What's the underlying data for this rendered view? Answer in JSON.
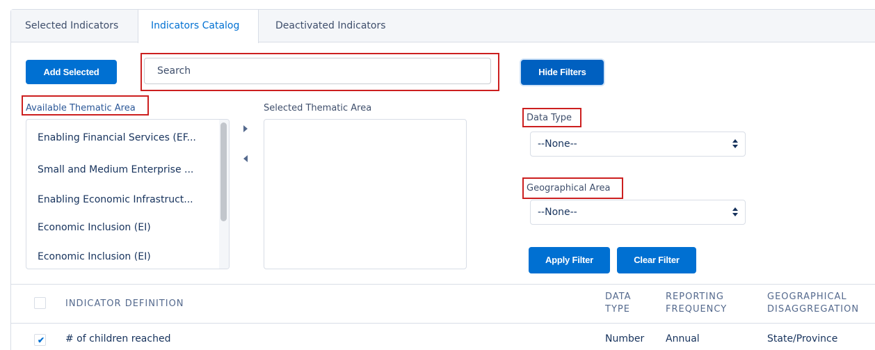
{
  "tabs": [
    "Selected Indicators",
    "Indicators Catalog",
    "Deactivated Indicators"
  ],
  "toolbar": {
    "add_selected": "Add Selected",
    "search_placeholder": "Search",
    "hide_filters": "Hide Filters"
  },
  "thematic": {
    "available_label": "Available Thematic Area",
    "selected_label": "Selected Thematic Area",
    "available_items": [
      "Enabling Financial Services (EF...",
      "Small and Medium Enterprise ...",
      "Enabling Economic Infrastruct...",
      "Economic Inclusion (EI)",
      "Economic Inclusion (EI)"
    ],
    "selected_items": []
  },
  "filters": {
    "data_type_label": "Data Type",
    "data_type_value": "--None--",
    "geo_label": "Geographical Area",
    "geo_value": "--None--",
    "apply": "Apply Filter",
    "clear": "Clear Filter"
  },
  "table": {
    "headers": {
      "definition": "INDICATOR DEFINITION",
      "data_type_1": "DATA",
      "data_type_2": "TYPE",
      "freq_1": "REPORTING",
      "freq_2": "FREQUENCY",
      "geo_1": "GEOGRAPHICAL",
      "geo_2": "DISAGGREGATION"
    },
    "rows": [
      {
        "checked": true,
        "definition": "# of children reached",
        "data_type": "Number",
        "frequency": "Annual",
        "geo": "State/Province"
      }
    ]
  },
  "colors": {
    "accent": "#0070d2",
    "highlight": "#cc1f1f"
  }
}
